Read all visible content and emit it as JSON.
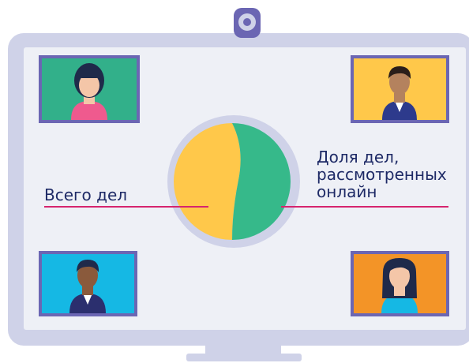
{
  "illustration": {
    "labels": {
      "total_cases": "Всего дел",
      "online_share_lines": [
        "Доля дел,",
        "рассмотренных",
        "онлайн"
      ]
    },
    "icons": {
      "webcam": "webcam-icon",
      "participants": [
        "person-woman-pink",
        "person-man-yellow",
        "person-man-blue",
        "person-woman-orange"
      ]
    },
    "pie": {
      "slices": [
        {
          "color": "#ffc84a"
        },
        {
          "color": "#36b98a"
        }
      ]
    },
    "colors": {
      "monitor_frame": "#cfd2e8",
      "screen": "#eef0f6",
      "leader_line": "#d6246e",
      "text": "#1e2a66",
      "tile_border": "#6b66b3"
    }
  }
}
